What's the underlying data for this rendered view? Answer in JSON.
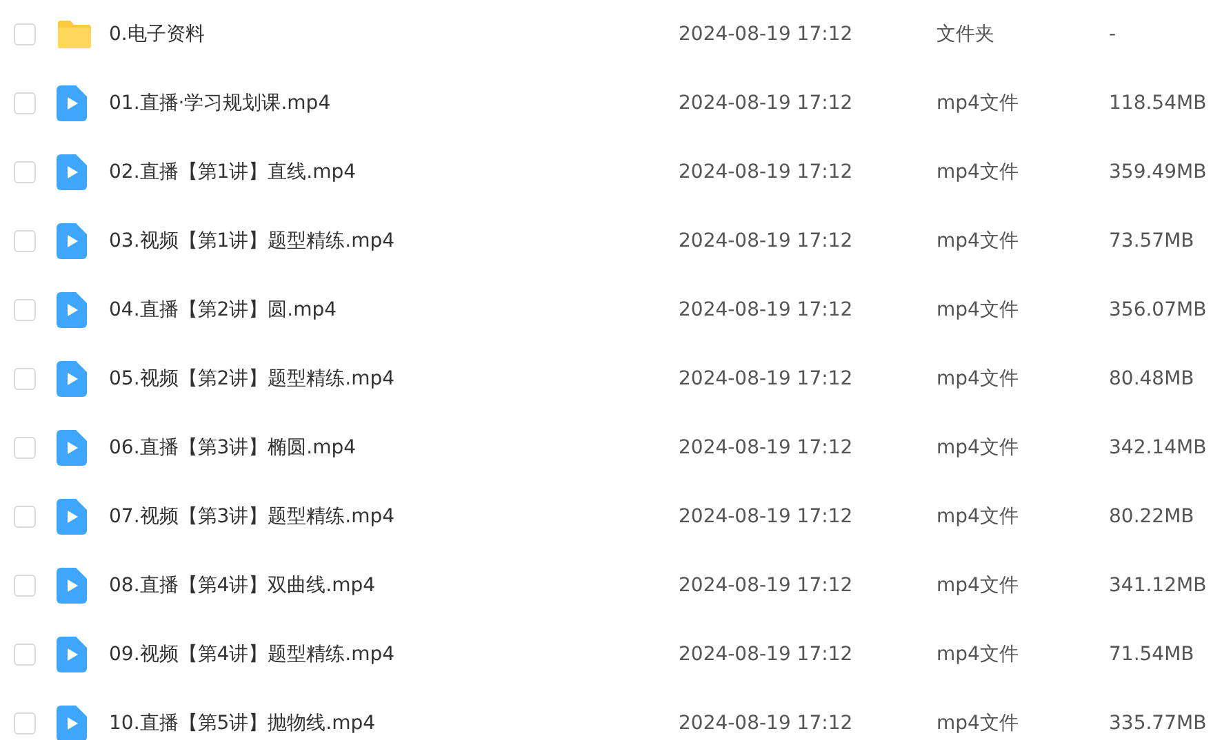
{
  "files": [
    {
      "kind": "folder",
      "checked": false,
      "name": "0.电子资料",
      "modified": "2024-08-19 17:12",
      "type": "文件夹",
      "size": "-"
    },
    {
      "kind": "video",
      "checked": false,
      "name": "01.直播·学习规划课.mp4",
      "modified": "2024-08-19 17:12",
      "type": "mp4文件",
      "size": "118.54MB"
    },
    {
      "kind": "video",
      "checked": false,
      "name": "02.直播【第1讲】直线.mp4",
      "modified": "2024-08-19 17:12",
      "type": "mp4文件",
      "size": "359.49MB"
    },
    {
      "kind": "video",
      "checked": false,
      "name": "03.视频【第1讲】题型精练.mp4",
      "modified": "2024-08-19 17:12",
      "type": "mp4文件",
      "size": "73.57MB"
    },
    {
      "kind": "video",
      "checked": false,
      "name": "04.直播【第2讲】圆.mp4",
      "modified": "2024-08-19 17:12",
      "type": "mp4文件",
      "size": "356.07MB"
    },
    {
      "kind": "video",
      "checked": false,
      "name": "05.视频【第2讲】题型精练.mp4",
      "modified": "2024-08-19 17:12",
      "type": "mp4文件",
      "size": "80.48MB"
    },
    {
      "kind": "video",
      "checked": false,
      "name": "06.直播【第3讲】椭圆.mp4",
      "modified": "2024-08-19 17:12",
      "type": "mp4文件",
      "size": "342.14MB"
    },
    {
      "kind": "video",
      "checked": false,
      "name": "07.视频【第3讲】题型精练.mp4",
      "modified": "2024-08-19 17:12",
      "type": "mp4文件",
      "size": "80.22MB"
    },
    {
      "kind": "video",
      "checked": false,
      "name": "08.直播【第4讲】双曲线.mp4",
      "modified": "2024-08-19 17:12",
      "type": "mp4文件",
      "size": "341.12MB"
    },
    {
      "kind": "video",
      "checked": false,
      "name": "09.视频【第4讲】题型精练.mp4",
      "modified": "2024-08-19 17:12",
      "type": "mp4文件",
      "size": "71.54MB"
    },
    {
      "kind": "video",
      "checked": false,
      "name": "10.直播【第5讲】抛物线.mp4",
      "modified": "2024-08-19 17:12",
      "type": "mp4文件",
      "size": "335.77MB"
    }
  ]
}
